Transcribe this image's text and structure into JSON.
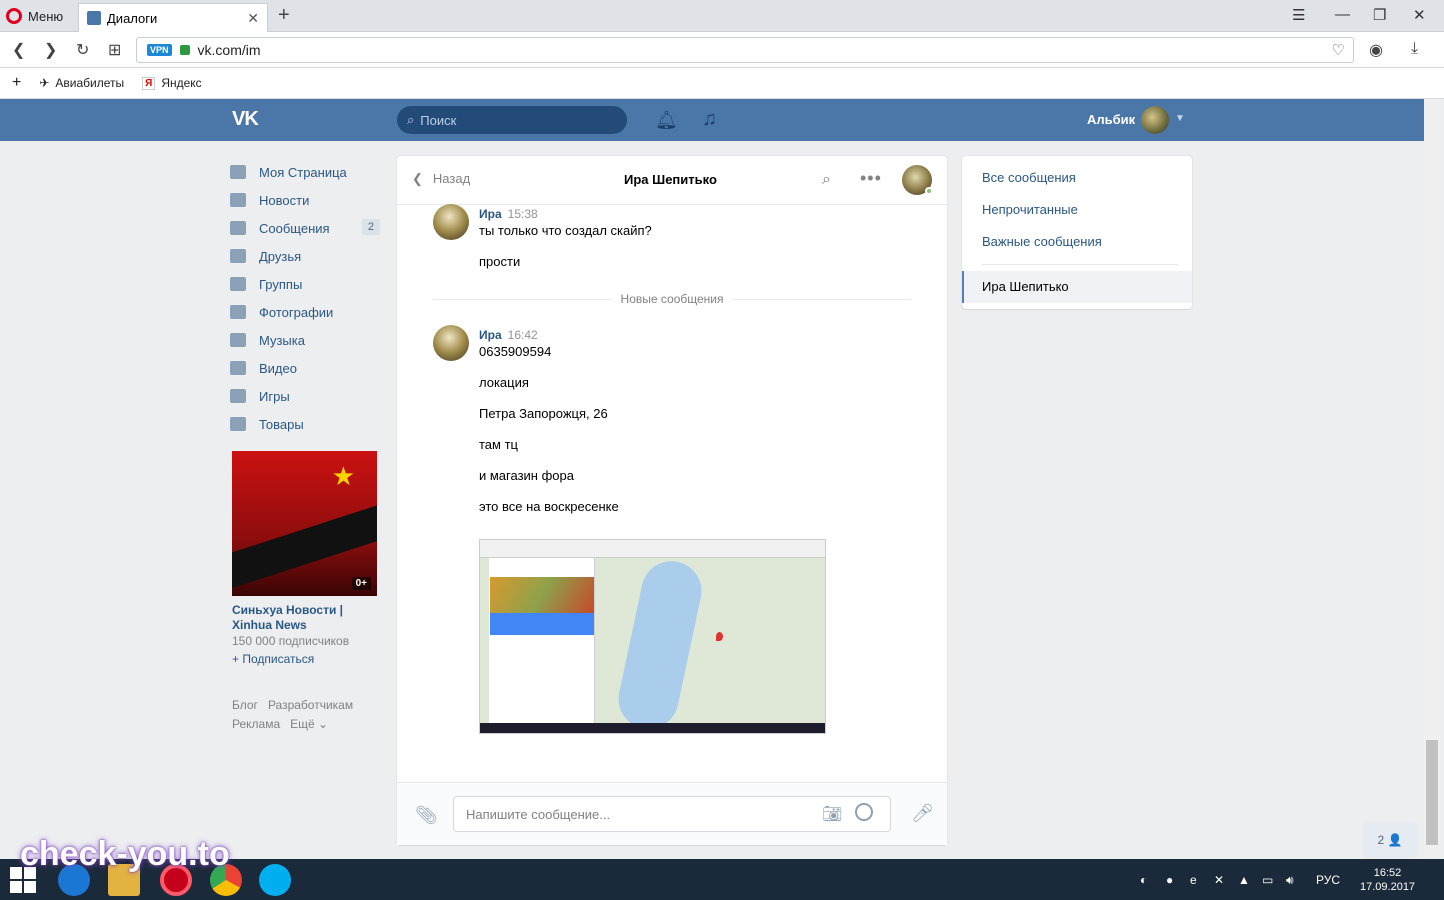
{
  "browser": {
    "menu_label": "Меню",
    "tab_title": "Диалоги",
    "vpn_label": "VPN",
    "url": "vk.com/im",
    "bookmarks": [
      "Авиабилеты",
      "Яндекс"
    ]
  },
  "header": {
    "search_placeholder": "Поиск",
    "user_name": "Альбик"
  },
  "left_menu": [
    {
      "label": "Моя Страница"
    },
    {
      "label": "Новости"
    },
    {
      "label": "Сообщения",
      "badge": "2"
    },
    {
      "label": "Друзья"
    },
    {
      "label": "Группы"
    },
    {
      "label": "Фотографии"
    },
    {
      "label": "Музыка"
    },
    {
      "label": "Видео"
    },
    {
      "label": "Игры"
    },
    {
      "label": "Товары"
    }
  ],
  "ad": {
    "age": "0+",
    "title": "Синьхуа Новости | Xinhua News",
    "subscribers": "150 000 подписчиков",
    "subscribe": "+ Подписаться"
  },
  "footer_links": [
    "Блог",
    "Разработчикам",
    "Реклама",
    "Ещё ⌄"
  ],
  "chat": {
    "back_label": "Назад",
    "contact_name": "Ира Шепитько",
    "divider_label": "Новые сообщения",
    "groups": [
      {
        "author": "Ира",
        "time": "15:38",
        "messages": [
          "ты только что создал скайп?",
          "прости"
        ]
      },
      {
        "author": "Ира",
        "time": "16:42",
        "messages": [
          "0635909594",
          "локация",
          "Петра Запорожця, 26",
          "там тц",
          "и магазин фора",
          "это все на воскресенке"
        ]
      }
    ],
    "composer_placeholder": "Напишите сообщение..."
  },
  "right_menu": {
    "items": [
      "Все сообщения",
      "Непрочитанные",
      "Важные сообщения"
    ],
    "selected": "Ира Шепитько"
  },
  "friends_online": "2 👤",
  "watermark": "check-you.to",
  "taskbar": {
    "lang": "РУС",
    "time": "16:52",
    "date": "17.09.2017"
  },
  "colors": {
    "vk_blue": "#4a76a8",
    "link": "#2a5885",
    "bg": "#edeef0"
  }
}
